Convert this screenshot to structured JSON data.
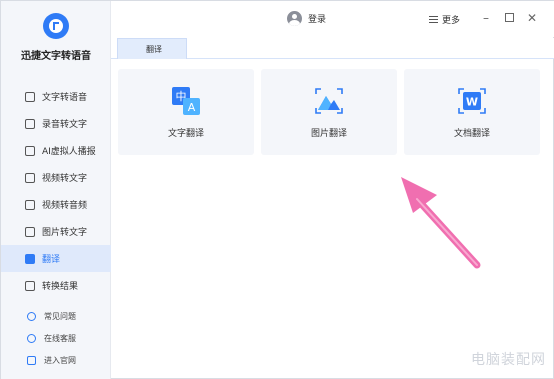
{
  "app": {
    "name": "迅捷文字转语音"
  },
  "sidebar": {
    "items": [
      {
        "label": "文字转语音"
      },
      {
        "label": "录音转文字"
      },
      {
        "label": "AI虚拟人播报"
      },
      {
        "label": "视频转文字"
      },
      {
        "label": "视频转音频"
      },
      {
        "label": "图片转文字"
      },
      {
        "label": "翻译"
      },
      {
        "label": "转换结果"
      }
    ],
    "footer": [
      {
        "label": "常见问题"
      },
      {
        "label": "在线客服"
      },
      {
        "label": "进入官网"
      }
    ]
  },
  "titlebar": {
    "login": "登录",
    "more": "更多"
  },
  "tabs": [
    {
      "label": "翻译"
    }
  ],
  "cards": [
    {
      "label": "文字翻译",
      "icon": "text-translate-icon"
    },
    {
      "label": "图片翻译",
      "icon": "image-translate-icon"
    },
    {
      "label": "文档翻译",
      "icon": "document-translate-icon"
    }
  ],
  "colors": {
    "accent": "#2f7bf6",
    "arrow": "#f06fb0"
  },
  "watermark": "电脑装配网"
}
